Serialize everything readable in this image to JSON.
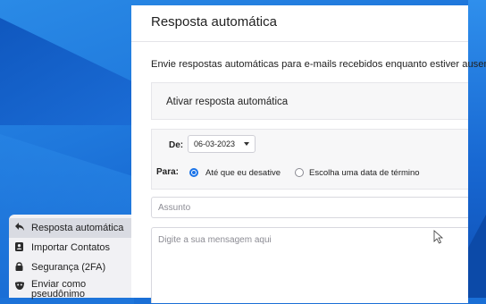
{
  "sidebar": {
    "items": [
      {
        "label": "Resposta automática",
        "icon": "reply-icon",
        "active": true
      },
      {
        "label": "Importar Contatos",
        "icon": "contact-import-icon",
        "active": false
      },
      {
        "label": "Segurança (2FA)",
        "icon": "lock-icon",
        "active": false
      },
      {
        "label": "Enviar como pseudônimo",
        "icon": "mask-icon",
        "active": false
      }
    ]
  },
  "panel": {
    "title": "Resposta automática",
    "description": "Envie respostas automáticas para e-mails recebidos enquanto estiver ausente.",
    "toggle_label": "Ativar resposta automática",
    "de_label": "De:",
    "date_value": "06-03-2023",
    "para_label": "Para:",
    "option_until_disabled": "Até que eu desative",
    "option_end_date": "Escolha uma data de término",
    "subject_placeholder": "Assunto",
    "message_placeholder": "Digite a sua mensagem aqui"
  },
  "colors": {
    "accent": "#1a73e8",
    "background": "#1a6fd6"
  }
}
